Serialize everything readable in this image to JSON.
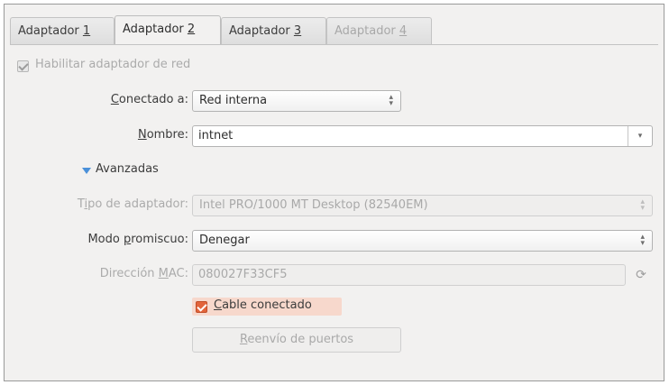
{
  "tabs": [
    {
      "label": "Adaptador ",
      "key": "1",
      "state": "normal"
    },
    {
      "label": "Adaptador ",
      "key": "2",
      "state": "active"
    },
    {
      "label": "Adaptador ",
      "key": "3",
      "state": "normal"
    },
    {
      "label": "Adaptador ",
      "key": "4",
      "state": "disabled"
    }
  ],
  "enable_adapter": {
    "label": "Habilitar adaptador de red",
    "checked": true,
    "disabled": true
  },
  "attached_to": {
    "label_key": "C",
    "label_rest": "onectado a:",
    "value": "Red interna"
  },
  "name": {
    "label_key": "N",
    "label_rest": "ombre:",
    "value": "intnet"
  },
  "advanced": {
    "label": "Avanzadas",
    "expanded": true
  },
  "adapter_type": {
    "label_pre": "T",
    "label_key": "i",
    "label_rest": "po de adaptador:",
    "value": "Intel PRO/1000 MT Desktop (82540EM)"
  },
  "promiscuous": {
    "label_pre": "Modo ",
    "label_key": "p",
    "label_rest": "romiscuo:",
    "value": "Denegar"
  },
  "mac": {
    "label_pre": "Dirección ",
    "label_key": "M",
    "label_rest": "AC:",
    "value": "080027F33CF5"
  },
  "cable": {
    "label_key": "C",
    "label_rest": "able conectado",
    "checked": true
  },
  "port_forwarding": {
    "label_key": "R",
    "label_rest": "eenvío de puertos"
  },
  "colors": {
    "accent": "#e2643b",
    "expander": "#4a90d9",
    "disabled_text": "#ababab"
  }
}
